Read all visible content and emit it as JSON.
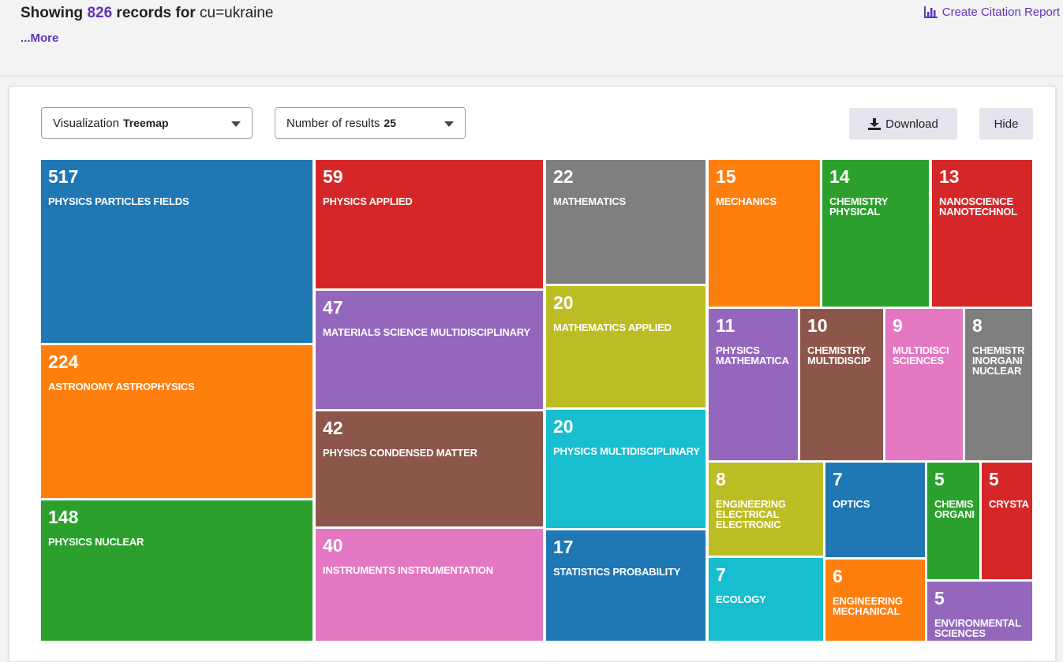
{
  "header": {
    "showing_label": "Showing",
    "record_count": "826",
    "records_for_label": "records for",
    "query": "cu=ukraine",
    "more_link": "...More",
    "citation_report": "Create Citation Report"
  },
  "controls": {
    "visualization_label": "Visualization",
    "visualization_value": "Treemap",
    "results_label": "Number of results",
    "results_value": "25",
    "download_label": "Download",
    "hide_label": "Hide"
  },
  "colors": {
    "blue": "#1f77b4",
    "orange": "#ff7f0e",
    "green": "#2ca02c",
    "red": "#d62728",
    "purple": "#9467bd",
    "brown": "#8c564b",
    "pink": "#e377c2",
    "gray": "#7f7f7f",
    "olive": "#bcbd22",
    "cyan": "#17becf",
    "accent": "#5e33bf"
  },
  "chart_data": {
    "type": "treemap",
    "title": "",
    "total": 826,
    "items": [
      {
        "label": "PHYSICS PARTICLES FIELDS",
        "value": 517,
        "color": "#1f77b4"
      },
      {
        "label": "ASTRONOMY ASTROPHYSICS",
        "value": 224,
        "color": "#ff7f0e"
      },
      {
        "label": "PHYSICS NUCLEAR",
        "value": 148,
        "color": "#2ca02c"
      },
      {
        "label": "PHYSICS APPLIED",
        "value": 59,
        "color": "#d62728"
      },
      {
        "label": "MATERIALS SCIENCE MULTIDISCIPLINARY",
        "value": 47,
        "color": "#9467bd"
      },
      {
        "label": "PHYSICS CONDENSED MATTER",
        "value": 42,
        "color": "#8c564b"
      },
      {
        "label": "INSTRUMENTS INSTRUMENTATION",
        "value": 40,
        "color": "#e377c2"
      },
      {
        "label": "MATHEMATICS",
        "value": 22,
        "color": "#7f7f7f"
      },
      {
        "label": "MATHEMATICS APPLIED",
        "value": 20,
        "color": "#bcbd22"
      },
      {
        "label": "PHYSICS MULTIDISCIPLINARY",
        "value": 20,
        "color": "#17becf"
      },
      {
        "label": "STATISTICS PROBABILITY",
        "value": 17,
        "color": "#1f77b4"
      },
      {
        "label": "MECHANICS",
        "value": 15,
        "color": "#ff7f0e"
      },
      {
        "label": "CHEMISTRY PHYSICAL",
        "value": 14,
        "color": "#2ca02c"
      },
      {
        "label": "NANOSCIENCE NANOTECHNOL",
        "value": 13,
        "color": "#d62728"
      },
      {
        "label": "PHYSICS MATHEMATICA",
        "value": 11,
        "color": "#9467bd"
      },
      {
        "label": "CHEMISTRY MULTIDISCIP",
        "value": 10,
        "color": "#8c564b"
      },
      {
        "label": "MULTIDISCI SCIENCES",
        "value": 9,
        "color": "#e377c2"
      },
      {
        "label": "CHEMISTR INORGANI NUCLEAR",
        "value": 8,
        "color": "#7f7f7f"
      },
      {
        "label": "ENGINEERING ELECTRICAL ELECTRONIC",
        "value": 8,
        "color": "#bcbd22"
      },
      {
        "label": "OPTICS",
        "value": 7,
        "color": "#1f77b4"
      },
      {
        "label": "ECOLOGY",
        "value": 7,
        "color": "#17becf"
      },
      {
        "label": "ENGINEERING MECHANICAL",
        "value": 6,
        "color": "#ff7f0e"
      },
      {
        "label": "CHEMIS ORGANI",
        "value": 5,
        "color": "#2ca02c"
      },
      {
        "label": "CRYSTA",
        "value": 5,
        "color": "#d62728"
      },
      {
        "label": "ENVIRONMENTAL SCIENCES",
        "value": 5,
        "color": "#9467bd"
      }
    ]
  }
}
